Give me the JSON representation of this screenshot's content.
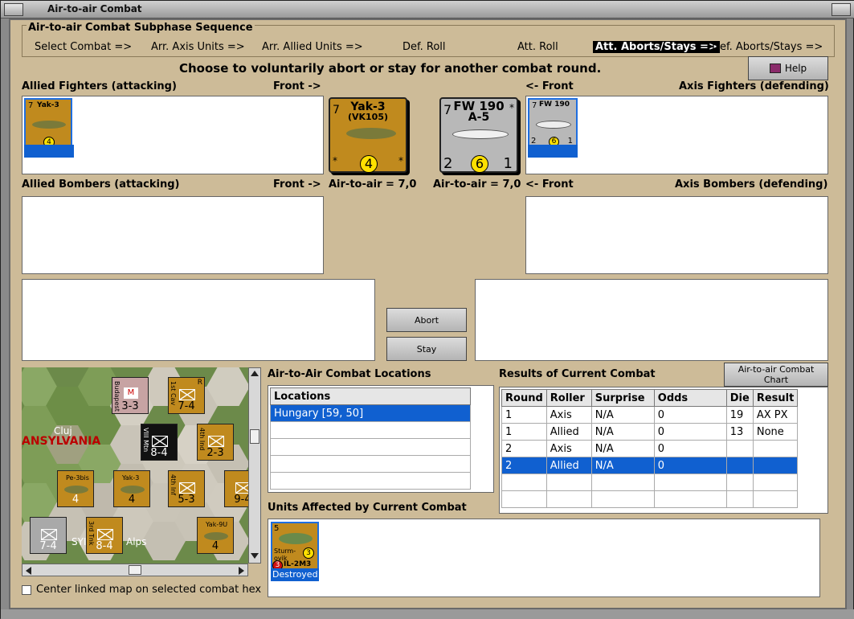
{
  "window": {
    "title": "Air-to-air Combat"
  },
  "sequence": {
    "title": "Air-to-air Combat Subphase Sequence",
    "steps": [
      "Select Combat =>",
      "Arr. Axis Units =>",
      "Arr. Allied Units =>",
      "Def. Roll",
      "Att. Roll",
      "Att. Aborts/Stays =>",
      "Def. Aborts/Stays =>"
    ],
    "active_index": 5
  },
  "instruction": "Choose to voluntarily abort or stay for another combat round.",
  "help_label": "Help",
  "allied_fighters": {
    "label": "Allied Fighters (attacking)",
    "front": "Front ->"
  },
  "axis_fighters": {
    "label": "Axis Fighters (defending)",
    "front": "<- Front"
  },
  "allied_bombers": {
    "label": "Allied Bombers (attacking)",
    "front": "Front ->"
  },
  "axis_bombers": {
    "label": "Axis Bombers (defending)",
    "front": "<- Front"
  },
  "allied_air": "Air-to-air = 7,0",
  "axis_air": "Air-to-air = 7,0",
  "allied_unit": {
    "name": "Yak-3",
    "sub": "(VK105)",
    "left": "7",
    "str": "4",
    "star": "*"
  },
  "axis_unit": {
    "name": "FW 190",
    "sub": "A-5",
    "left": "7",
    "a": "2",
    "b": "6",
    "c": "1",
    "star": "*"
  },
  "abort_label": "Abort",
  "stay_label": "Stay",
  "locations": {
    "title": "Air-to-Air Combat Locations",
    "header": "Locations",
    "items": [
      "Hungary [59, 50]"
    ]
  },
  "results": {
    "title": "Results of Current Combat",
    "chart_button": "Air-to-air Combat Chart",
    "columns": [
      "Round",
      "Roller",
      "Surprise",
      "Odds",
      "Die",
      "Result"
    ],
    "rows": [
      [
        "1",
        "Axis",
        "N/A",
        "0",
        "19",
        "AX PX"
      ],
      [
        "1",
        "Allied",
        "N/A",
        "0",
        "13",
        "None"
      ],
      [
        "2",
        "Axis",
        "N/A",
        "0",
        "",
        ""
      ],
      [
        "2",
        "Allied",
        "N/A",
        "0",
        "",
        ""
      ]
    ],
    "selected_row": 3
  },
  "affected": {
    "title": "Units Affected by Current Combat",
    "unit": {
      "top": "5",
      "name": "Sturm-ovik",
      "model": "IL-2M3",
      "red": "3",
      "yellow": "3",
      "status": "Destroyed"
    }
  },
  "map": {
    "region": "ANSYLVANIA",
    "city": "Cluj",
    "mountains": "Alps",
    "sy": "SYI",
    "counters": [
      {
        "label": "Budapest",
        "str": "3-3",
        "mark": "M"
      },
      {
        "label": "1st Cav",
        "str": "7-4",
        "mark": "R"
      },
      {
        "label": "VIII Mtn",
        "str": "8-4"
      },
      {
        "label": "4th Ind",
        "str": "2-3"
      },
      {
        "label": "Pe-3bis",
        "str": "4"
      },
      {
        "label": "Yak-3",
        "str": "4"
      },
      {
        "label": "4th Inf",
        "str": "5-3"
      },
      {
        "label": "",
        "str": "9-4"
      },
      {
        "label": "",
        "str": "7-4"
      },
      {
        "label": "3rd Tnk",
        "str": "8-4"
      },
      {
        "label": "Yak-9U",
        "str": "4"
      }
    ]
  },
  "center_checkbox": "Center linked map on selected combat hex"
}
